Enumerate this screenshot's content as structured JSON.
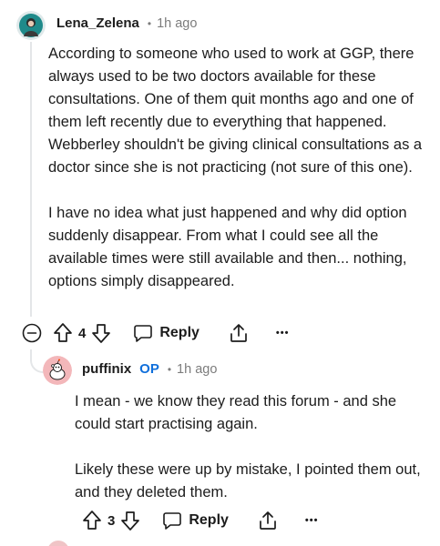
{
  "comment": {
    "username": "Lena_Zelena",
    "separator": "•",
    "time": "1h ago",
    "paragraphs": [
      "According to someone who used to work at GGP, there always used to be two doctors available for these consultations. One of them quit months ago and one of them left recently due to everything that happened. Webberley shouldn't be giving clinical consultations as a doctor since she is not practicing (not sure of this one).",
      "I have no idea what just happened and why did option suddenly disappear. From what I could see all the available times were still available and then... nothing, options simply disappeared."
    ],
    "vote_count": "4",
    "reply_label": "Reply",
    "more_label": "•••"
  },
  "reply": {
    "username": "puffinix",
    "op_badge": "OP",
    "separator": "•",
    "time": "1h ago",
    "paragraphs": [
      "I mean - we know they read this forum - and she could start practising again.",
      "Likely these were up by mistake, I pointed them out, and they deleted them."
    ],
    "vote_count": "3",
    "reply_label": "Reply",
    "more_label": "•••"
  },
  "colors": {
    "op_accent": "#0f6fdb",
    "muted_text": "#7c7c7c",
    "thread_line": "#e4e6e8",
    "reply_avatar_bg": "#f3b7ba",
    "main_avatar_bg": "#1f8a8a"
  }
}
